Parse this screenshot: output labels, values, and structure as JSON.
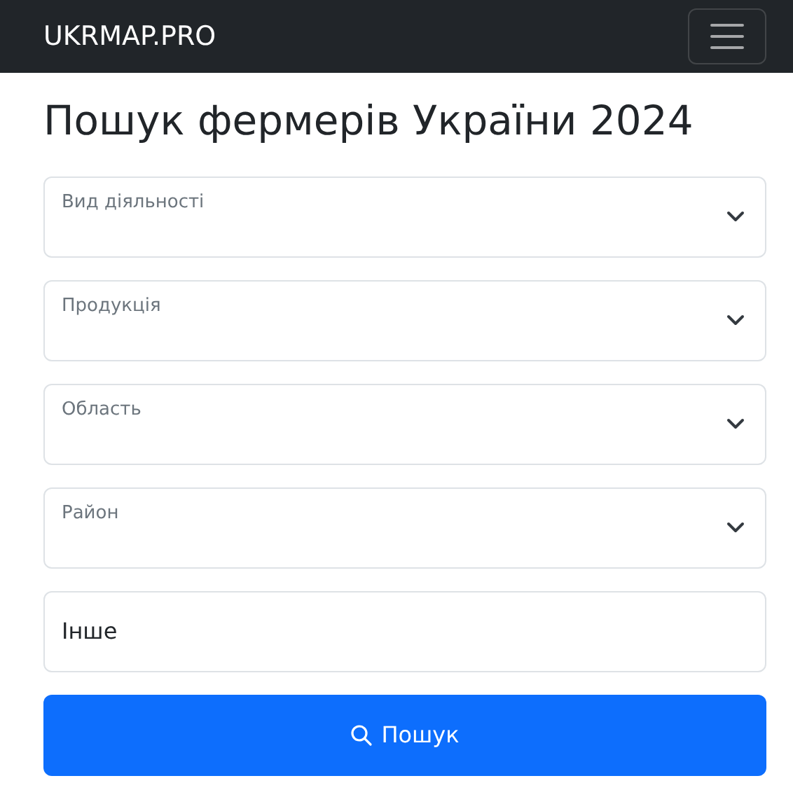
{
  "navbar": {
    "brand": "UKRMAP.PRO"
  },
  "title": "Пошук фермерів України 2024",
  "selects": [
    {
      "label": "Вид діяльності"
    },
    {
      "label": "Продукція"
    },
    {
      "label": "Область"
    },
    {
      "label": "Район"
    }
  ],
  "other_field": {
    "placeholder": "Інше"
  },
  "search_button": {
    "label": "Пошук"
  }
}
